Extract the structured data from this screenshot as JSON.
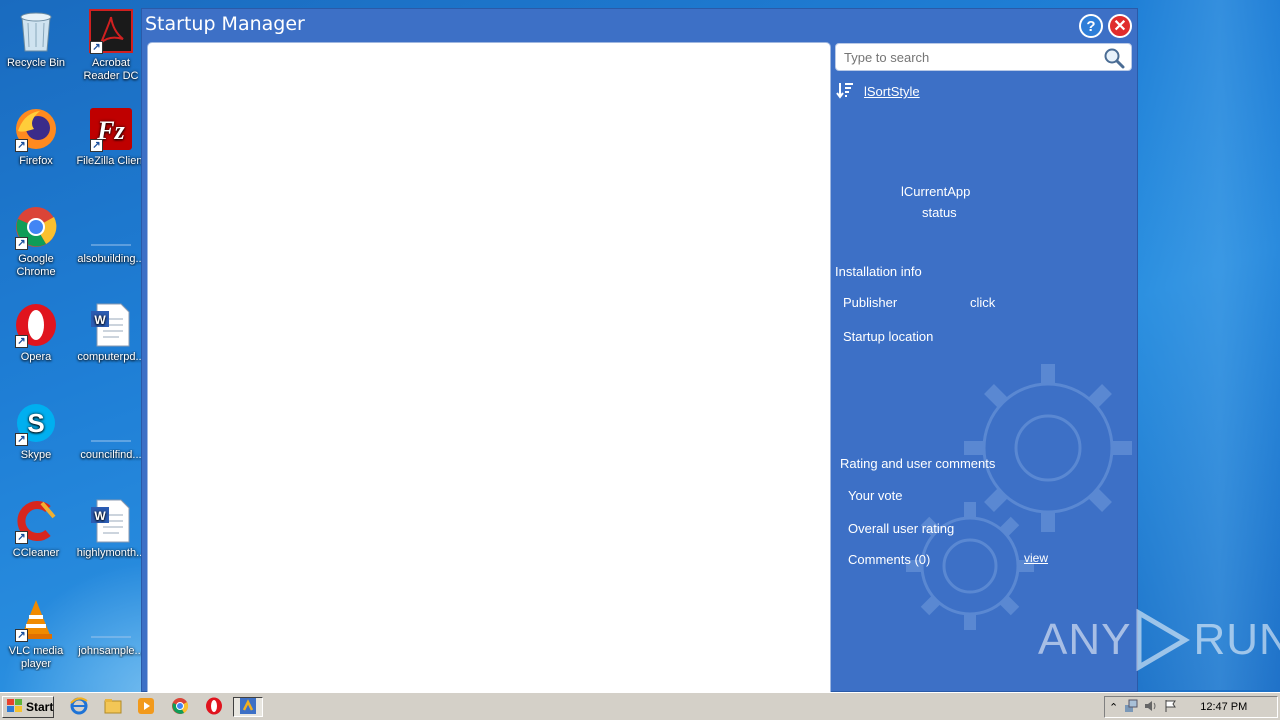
{
  "desktop": {
    "icons": [
      {
        "label": "Recycle Bin",
        "icon": "recycle-bin-icon"
      },
      {
        "label": "Acrobat Reader DC",
        "icon": "acrobat-icon"
      },
      {
        "label": "Firefox",
        "icon": "firefox-icon"
      },
      {
        "label": "FileZilla Client",
        "icon": "filezilla-icon"
      },
      {
        "label": "Google Chrome",
        "icon": "chrome-icon"
      },
      {
        "label": "alsobuilding...",
        "icon": "blank-file-icon"
      },
      {
        "label": "Opera",
        "icon": "opera-icon"
      },
      {
        "label": "computerpd...",
        "icon": "word-doc-icon"
      },
      {
        "label": "Skype",
        "icon": "skype-icon"
      },
      {
        "label": "councilfind...",
        "icon": "blank-file-icon"
      },
      {
        "label": "CCleaner",
        "icon": "ccleaner-icon"
      },
      {
        "label": "highlymonth...",
        "icon": "word-doc-icon"
      },
      {
        "label": "VLC media player",
        "icon": "vlc-icon"
      },
      {
        "label": "johnsample...",
        "icon": "blank-file-icon"
      }
    ]
  },
  "window": {
    "title": "Startup Manager",
    "help_label": "?",
    "close_label": "✕"
  },
  "sidebar": {
    "search_placeholder": "Type to search",
    "sort_label": "lSortStyle",
    "current_app": "lCurrentApp",
    "status": "status",
    "install_heading": "Installation info",
    "publisher_label": "Publisher",
    "publisher_value": "click",
    "startup_location_label": "Startup location",
    "rating_heading": "Rating and user comments",
    "your_vote_label": "Your vote",
    "overall_rating_label": "Overall user rating",
    "comments_label": "Comments (0)",
    "view_link": "view"
  },
  "watermark": {
    "text_left": "ANY",
    "text_right": "RUN"
  },
  "taskbar": {
    "start_label": "Start",
    "clock": "12:47 PM",
    "pinned": [
      "ie-icon",
      "explorer-icon",
      "media-player-icon",
      "chrome-icon",
      "opera-icon",
      "startup-manager-icon"
    ]
  },
  "colors": {
    "window_bg": "#3d70c6",
    "desktop_bg": "#1f7fd6",
    "close_red": "#e02c2c",
    "help_blue": "#2e7ed8"
  }
}
